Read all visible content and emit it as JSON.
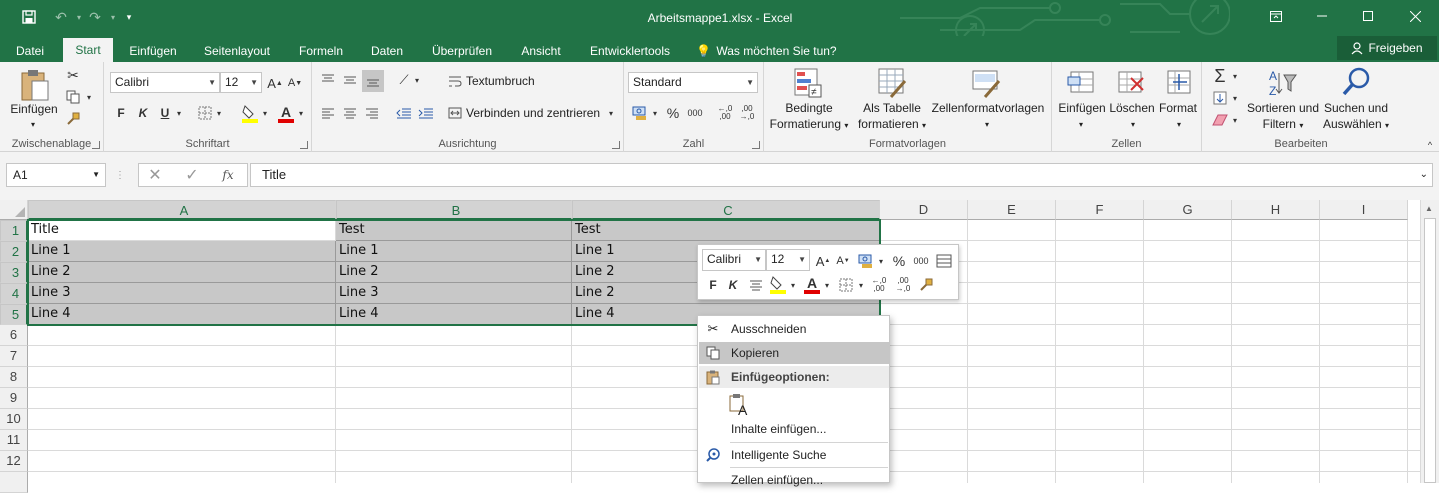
{
  "window": {
    "title": "Arbeitsmappe1.xlsx - Excel"
  },
  "tabs": [
    "Datei",
    "Start",
    "Einfügen",
    "Seitenlayout",
    "Formeln",
    "Daten",
    "Überprüfen",
    "Ansicht",
    "Entwicklertools"
  ],
  "tell_me": "Was möchten Sie tun?",
  "share_label": "Freigeben",
  "ribbon": {
    "clipboard": {
      "label": "Zwischenablage",
      "paste": "Einfügen"
    },
    "font": {
      "label": "Schriftart",
      "name": "Calibri",
      "size": "12",
      "bold": "F",
      "italic": "K",
      "underline": "U"
    },
    "alignment": {
      "label": "Ausrichtung",
      "wrap": "Textumbruch",
      "merge": "Verbinden und zentrieren"
    },
    "number": {
      "label": "Zahl",
      "format": "Standard",
      "percent": "%",
      "thousands": "000"
    },
    "styles": {
      "label": "Formatvorlagen",
      "conditional_1": "Bedingte",
      "conditional_2": "Formatierung",
      "table_1": "Als Tabelle",
      "table_2": "formatieren",
      "cell_styles": "Zellenformatvorlagen"
    },
    "cells": {
      "label": "Zellen",
      "insert": "Einfügen",
      "delete": "Löschen",
      "format": "Format"
    },
    "editing": {
      "label": "Bearbeiten",
      "sort_1": "Sortieren und",
      "sort_2": "Filtern",
      "find_1": "Suchen und",
      "find_2": "Auswählen"
    }
  },
  "formula_bar": {
    "name_box": "A1",
    "fx": "fx",
    "content": "Title"
  },
  "columns": [
    "A",
    "B",
    "C",
    "D",
    "E",
    "F",
    "G",
    "H",
    "I"
  ],
  "rows": [
    "1",
    "2",
    "3",
    "4",
    "5",
    "6",
    "7",
    "8",
    "9",
    "10",
    "11",
    "12"
  ],
  "cells": {
    "r1": [
      "Title",
      "Test",
      "Test"
    ],
    "r2": [
      "Line 1",
      "Line 1",
      "Line 1"
    ],
    "r3": [
      "Line 2",
      "Line 2",
      "Line 2"
    ],
    "r4": [
      "Line 3",
      "Line 3",
      "Line 2"
    ],
    "r5": [
      "Line 4",
      "Line 4",
      "Line 4"
    ]
  },
  "mini_toolbar": {
    "font": "Calibri",
    "size": "12",
    "bold": "F",
    "italic": "K",
    "percent": "%",
    "thousands": "000"
  },
  "context_menu": {
    "cut": "Ausschneiden",
    "copy": "Kopieren",
    "paste_options": "Einfügeoptionen:",
    "paste_special": "Inhalte einfügen...",
    "smart_lookup": "Intelligente Suche",
    "insert_cells": "Zellen einfügen..."
  },
  "colors": {
    "excel_green": "#217346",
    "selection_fill": "#c8c8c8"
  }
}
